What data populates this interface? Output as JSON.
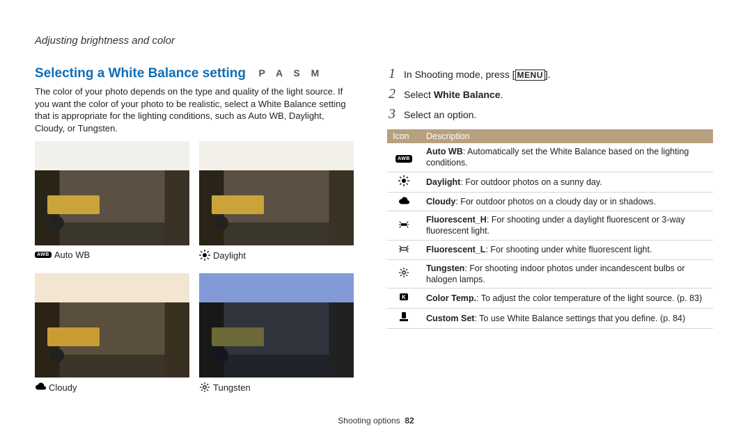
{
  "chapter": "Adjusting brightness and color",
  "heading": "Selecting a White Balance setting",
  "modes": "P A S M",
  "intro": "The color of your photo depends on the type and quality of the light source. If you want the color of your photo to be realistic, select a White Balance setting that is appropriate for the lighting conditions, such as Auto WB, Daylight, Cloudy, or Tungsten.",
  "gallery": {
    "autoWB": "Auto WB",
    "daylight": "Daylight",
    "cloudy": "Cloudy",
    "tungsten": "Tungsten"
  },
  "steps": {
    "s1_a": "In Shooting mode, press [",
    "s1_menu": "MENU",
    "s1_b": "].",
    "s2_a": "Select ",
    "s2_bold": "White Balance",
    "s2_b": ".",
    "s3": "Select an option."
  },
  "table": {
    "hIcon": "Icon",
    "hDesc": "Description",
    "rows": {
      "awb_b": "Auto WB",
      "awb_t": ": Automatically set the White Balance based on the lighting conditions.",
      "day_b": "Daylight",
      "day_t": ": For outdoor photos on a sunny day.",
      "cloud_b": "Cloudy",
      "cloud_t": ": For outdoor photos on a cloudy day or in shadows.",
      "fh_b": "Fluorescent_H",
      "fh_t": ": For shooting under a daylight fluorescent or 3-way fluorescent light.",
      "fl_b": "Fluorescent_L",
      "fl_t": ": For shooting under white fluorescent light.",
      "tu_b": "Tungsten",
      "tu_t": ": For shooting indoor photos under incandescent bulbs or halogen lamps.",
      "ct_b": "Color Temp.",
      "ct_t": ": To adjust the color temperature of the light source. (p. 83)",
      "cs_b": "Custom Set",
      "cs_t": ": To use White Balance settings that you define. (p. 84)"
    }
  },
  "footer": {
    "section": "Shooting options",
    "page": "82"
  }
}
